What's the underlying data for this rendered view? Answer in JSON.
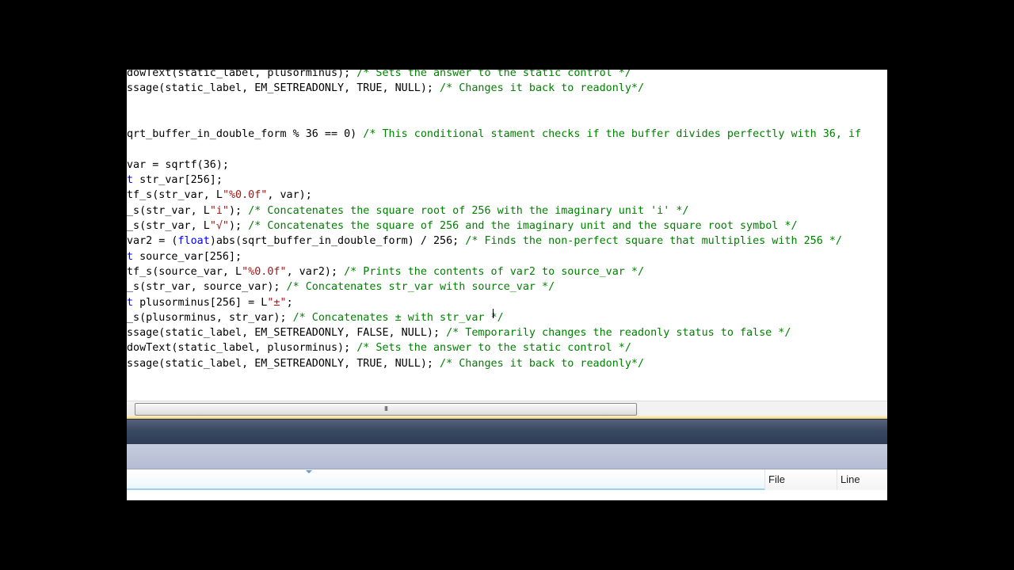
{
  "editor": {
    "lines": [
      [
        [
          "code",
          "dowText(static_label, plusorminus); "
        ],
        [
          "com",
          "/* Sets the answer to the static control */"
        ]
      ],
      [
        [
          "code",
          "ssage(static_label, EM_SETREADONLY, TRUE, NULL); "
        ],
        [
          "com",
          "/* Changes it back to readonly*/"
        ]
      ],
      [],
      [],
      [
        [
          "code",
          "qrt_buffer_in_double_form % 36 == 0) "
        ],
        [
          "com",
          "/* This conditional stament checks if the buffer divides perfectly with 36, if"
        ]
      ],
      [],
      [
        [
          "code",
          "var = sqrtf(36);"
        ]
      ],
      [
        [
          "kw",
          "t"
        ],
        [
          "code",
          " str_var[256];"
        ]
      ],
      [
        [
          "code",
          "tf_s(str_var, L"
        ],
        [
          "str",
          "\"%0.0f\""
        ],
        [
          "code",
          ", var);"
        ]
      ],
      [
        [
          "code",
          "_s(str_var, L"
        ],
        [
          "str",
          "\"i\""
        ],
        [
          "code",
          "); "
        ],
        [
          "com",
          "/* Concatenates the square root of 256 with the imaginary unit 'i' */"
        ]
      ],
      [
        [
          "code",
          "_s(str_var, L"
        ],
        [
          "str",
          "\"√\""
        ],
        [
          "code",
          "); "
        ],
        [
          "com",
          "/* Concatenates the square of 256 and the imaginary unit and the square root symbol */"
        ]
      ],
      [
        [
          "code",
          "var2 = ("
        ],
        [
          "kw",
          "float"
        ],
        [
          "code",
          ")abs(sqrt_buffer_in_double_form) / 256; "
        ],
        [
          "com",
          "/* Finds the non-perfect square that multiplies with 256 */"
        ]
      ],
      [
        [
          "kw",
          "t"
        ],
        [
          "code",
          " source_var[256];"
        ]
      ],
      [
        [
          "code",
          "tf_s(source_var, L"
        ],
        [
          "str",
          "\"%0.0f\""
        ],
        [
          "code",
          ", var2); "
        ],
        [
          "com",
          "/* Prints the contents of var2 to source_var */"
        ]
      ],
      [
        [
          "code",
          "_s(str_var, source_var); "
        ],
        [
          "com",
          "/* Concatenates str_var with source_var */"
        ]
      ],
      [
        [
          "kw",
          "t"
        ],
        [
          "code",
          " plusorminus[256] = L"
        ],
        [
          "str",
          "\"±\""
        ],
        [
          "code",
          ";"
        ]
      ],
      [
        [
          "code",
          "_s(plusorminus, str_var); "
        ],
        [
          "com",
          "/* Concatenates ± with str_var */"
        ]
      ],
      [
        [
          "code",
          "ssage(static_label, EM_SETREADONLY, FALSE, NULL); "
        ],
        [
          "com",
          "/* Temporarily changes the readonly status to false */"
        ]
      ],
      [
        [
          "code",
          "dowText(static_label, plusorminus); "
        ],
        [
          "com",
          "/* Sets the answer to the static control */"
        ]
      ],
      [
        [
          "code",
          "ssage(static_label, EM_SETREADONLY, TRUE, NULL); "
        ],
        [
          "com",
          "/* Changes it back to readonly*/"
        ]
      ]
    ]
  },
  "scrollbar": {
    "grip_glyph": "III"
  },
  "error_list": {
    "columns": {
      "file": "File",
      "line": "Line"
    }
  },
  "colors": {
    "keyword": "#0000ff",
    "string": "#a31515",
    "comment": "#008000",
    "code": "#000000"
  }
}
